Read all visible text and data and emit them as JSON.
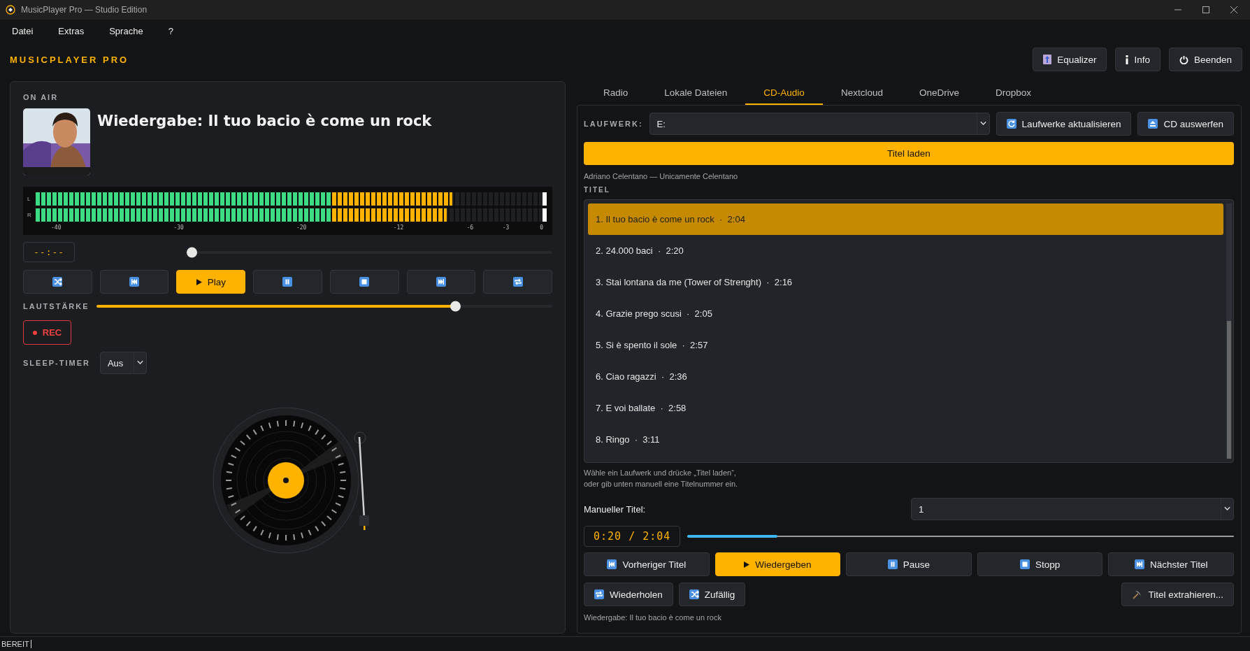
{
  "window": {
    "title": "MusicPlayer Pro — Studio Edition"
  },
  "menu": [
    "Datei",
    "Extras",
    "Sprache",
    "?"
  ],
  "header": {
    "title": "MUSICPLAYER PRO",
    "buttons": [
      {
        "kind": "equalizer",
        "label": "Equalizer"
      },
      {
        "kind": "info",
        "label": "Info"
      },
      {
        "kind": "power",
        "label": "Beenden"
      }
    ]
  },
  "now_playing": {
    "label": "ON AIR",
    "title": "Wiedergabe: Il tuo bacio è come un rock",
    "vu_meter": {
      "channels": [
        {
          "name": "L",
          "level": 0.824
        },
        {
          "name": "R",
          "level": 0.813
        }
      ],
      "scale": [
        "-40",
        "-30",
        "-20",
        "-12",
        "-6",
        "-3",
        "0"
      ]
    },
    "time": "--:--",
    "seek": {
      "level": 0
    },
    "transport": [
      {
        "kind": "shuffle",
        "active": false
      },
      {
        "kind": "previous",
        "active": false
      },
      {
        "kind": "play",
        "label": "Play",
        "active": true
      },
      {
        "kind": "pause",
        "active": false
      },
      {
        "kind": "stop",
        "active": false
      },
      {
        "kind": "next",
        "active": false
      },
      {
        "kind": "repeat",
        "active": false
      }
    ],
    "volume": {
      "label": "LAUTSTÄRKE",
      "level": 0.795
    },
    "rec": {
      "label": "REC"
    },
    "sleep_timer": {
      "label": "SLEEP-TIMER",
      "value": "Aus"
    }
  },
  "tabs": [
    {
      "label": "Radio",
      "selected": false
    },
    {
      "label": "Lokale Dateien",
      "selected": false
    },
    {
      "label": "CD-Audio",
      "selected": true
    },
    {
      "label": "Nextcloud",
      "selected": false
    },
    {
      "label": "OneDrive",
      "selected": false
    },
    {
      "label": "Dropbox",
      "selected": false
    }
  ],
  "cd": {
    "drive_label": "LAUFWERK:",
    "drive": "E:",
    "drive_buttons": [
      {
        "kind": "refresh",
        "label": "Laufwerke aktualisieren"
      },
      {
        "kind": "eject",
        "label": "CD auswerfen"
      }
    ],
    "load_button": "Titel laden",
    "album": "Adriano Celentano — Unicamente Celentano",
    "list_label": "TITEL",
    "tracks": [
      {
        "label": "1. Il tuo bacio è come un rock  ·  2:04",
        "selected": true
      },
      {
        "label": "2. 24.000 baci  ·  2:20",
        "selected": false
      },
      {
        "label": "3. Stai lontana da me (Tower of Strenght)  ·  2:16",
        "selected": false
      },
      {
        "label": "4. Grazie prego scusi  ·  2:05",
        "selected": false
      },
      {
        "label": "5. Si è spento il sole  ·  2:57",
        "selected": false
      },
      {
        "label": "6. Ciao ragazzi  ·  2:36",
        "selected": false
      },
      {
        "label": "7. E voi ballate  ·  2:58",
        "selected": false
      },
      {
        "label": "8. Ringo  ·  3:11",
        "selected": false
      }
    ],
    "hint": "Wähle ein Laufwerk und drücke „Titel laden“,\noder gib unten manuell eine Titelnummer ein.",
    "manual": {
      "label": "Manueller Titel:",
      "value": "1"
    },
    "time": "0:20 / 2:04",
    "progress": {
      "level": 0.165
    },
    "controls": [
      {
        "kind": "previous",
        "label": "Vorheriger Titel",
        "active": false
      },
      {
        "kind": "play",
        "label": "Wiedergeben",
        "active": true
      },
      {
        "kind": "pause",
        "label": "Pause",
        "active": false
      },
      {
        "kind": "stop",
        "label": "Stopp",
        "active": false
      },
      {
        "kind": "next",
        "label": "Nächster Titel",
        "active": false
      }
    ],
    "extra_left": [
      {
        "kind": "repeat",
        "label": "Wiederholen"
      },
      {
        "kind": "shuffle",
        "label": "Zufällig"
      }
    ],
    "extra_right": {
      "kind": "pick",
      "label": "Titel extrahieren..."
    },
    "status": "Wiedergabe: Il tuo bacio è come un rock"
  },
  "status_bar": "BEREIT"
}
